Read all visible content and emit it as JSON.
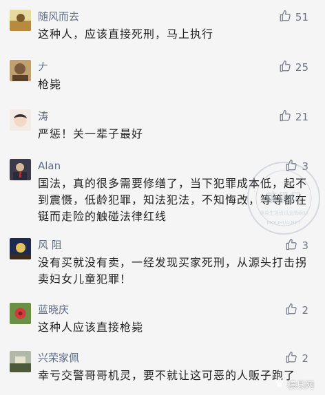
{
  "comments": [
    {
      "author": "随风而去",
      "text": "这种人，应该直接死刑，马上执行",
      "likes": "51",
      "avatar_colors": [
        "#b48b3f",
        "#e8d9a0"
      ]
    },
    {
      "author": "𠂇",
      "text": "枪毙",
      "likes": "25",
      "avatar_colors": [
        "#7a5a3c",
        "#c0a070"
      ]
    },
    {
      "author": "涛",
      "text": "严惩！关一辈子最好",
      "likes": "21",
      "avatar_colors": [
        "#f3d8c6",
        "#3a2d2a"
      ]
    },
    {
      "author": "Alan",
      "text": "国法，真的很多需要修缮了，当下犯罪成本低，起不到震慑，低龄犯罪，知法犯法，不知悔改，等等都在铤而走险的触碰法律红线",
      "likes": "3",
      "avatar_colors": [
        "#2a2a3a",
        "#a33"
      ]
    },
    {
      "author": "风 阻",
      "text": "没有买就没有卖，一经发现买家死刑，从源头打击拐卖妇女儿童犯罪！",
      "likes": "3",
      "avatar_colors": [
        "#1e2b4e",
        "#e6c35a"
      ]
    },
    {
      "author": "蓝晓庆",
      "text": "这种人应该直接枪毙",
      "likes": "2",
      "avatar_colors": [
        "#6b8f45",
        "#d23b3b"
      ]
    },
    {
      "author": "兴荣家佩",
      "text": "幸亏交警哥哥机灵，要不就让这可恶的人贩子跑了",
      "likes": "2",
      "avatar_colors": [
        "#b0b8a8",
        "#4c5a3a"
      ]
    }
  ],
  "icons": {
    "like": "thumbs-up-icon"
  },
  "watermark_brand": "莱县风",
  "watermark_text": "横县生活资讯品牌网站",
  "watermark_url": "MOLIHUA.NET",
  "logo_text": "横县网",
  "colors": {
    "name": "#5d6c87",
    "text": "#222222",
    "count": "#6f7587",
    "background": "#f5f5f5"
  }
}
